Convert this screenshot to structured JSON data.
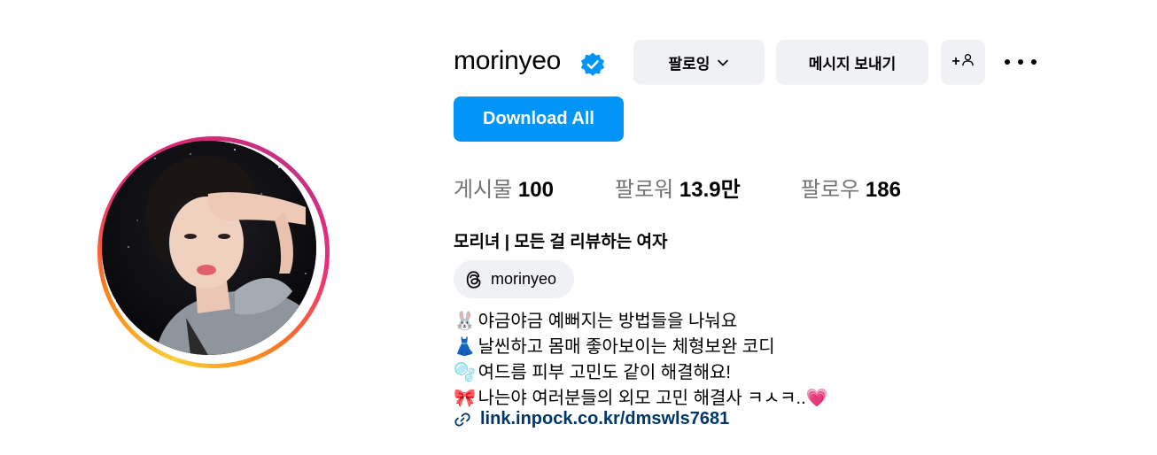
{
  "profile": {
    "username": "morinyeo",
    "verified": true,
    "verified_color": "#0095f6"
  },
  "actions": {
    "following_label": "팔로잉",
    "message_label": "메시지 보내기",
    "add_user_label": "+",
    "more_icon": "more-horizontal-icon",
    "download_label": "Download All",
    "download_color": "#0095f6"
  },
  "stats": {
    "posts_label": "게시물",
    "posts_value": "100",
    "followers_label": "팔로워",
    "followers_value": "13.9만",
    "following_label": "팔로우",
    "following_value": "186"
  },
  "bio": {
    "display_name": "모리녀 | 모든 걸 리뷰하는 여자",
    "threads_handle": "morinyeo",
    "lines": [
      {
        "emoji": "🐰",
        "text": "야금야금 예뻐지는 방법들을 나눠요"
      },
      {
        "emoji": "👗",
        "text": "날씬하고 몸매 좋아보이는 체형보완 코디"
      },
      {
        "emoji": "🫧",
        "text": "여드름 피부 고민도 같이 해결해요!"
      },
      {
        "emoji": "🎀",
        "text": "나는야 여러분들의 외모 고민 해결사 ㅋㅅㅋ..💗"
      }
    ],
    "link_text": "link.inpock.co.kr/dmswls7681",
    "link_color": "#00376b"
  }
}
